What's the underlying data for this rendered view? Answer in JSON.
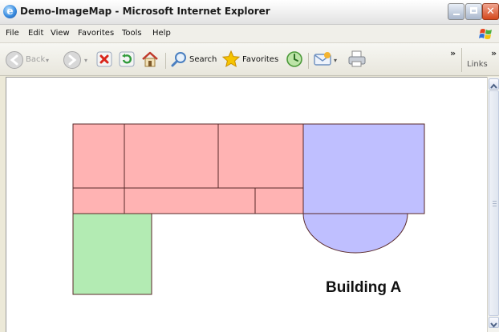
{
  "window": {
    "title": "Demo-ImageMap - Microsoft Internet Explorer",
    "icon": "ie-logo-icon"
  },
  "menu": [
    "File",
    "Edit",
    "View",
    "Favorites",
    "Tools",
    "Help"
  ],
  "toolbar": {
    "back_label": "Back",
    "search_label": "Search",
    "favorites_label": "Favorites",
    "overflow_glyph": "»",
    "links_label": "Links"
  },
  "content": {
    "building_label": "Building A",
    "colors": {
      "red_room": "#ffb3b3",
      "blue_room": "#bfbfff",
      "green_room": "#b3ebb3",
      "outline": "#5a2a2a"
    },
    "rooms": [
      {
        "name": "room-red-1",
        "color": "red"
      },
      {
        "name": "room-red-2",
        "color": "red"
      },
      {
        "name": "room-red-3",
        "color": "red"
      },
      {
        "name": "room-red-4",
        "color": "red"
      },
      {
        "name": "room-red-5",
        "color": "red"
      },
      {
        "name": "room-red-6",
        "color": "red"
      },
      {
        "name": "room-blue",
        "color": "blue"
      },
      {
        "name": "room-blue-semicircle",
        "color": "blue"
      },
      {
        "name": "room-green",
        "color": "green"
      }
    ]
  }
}
